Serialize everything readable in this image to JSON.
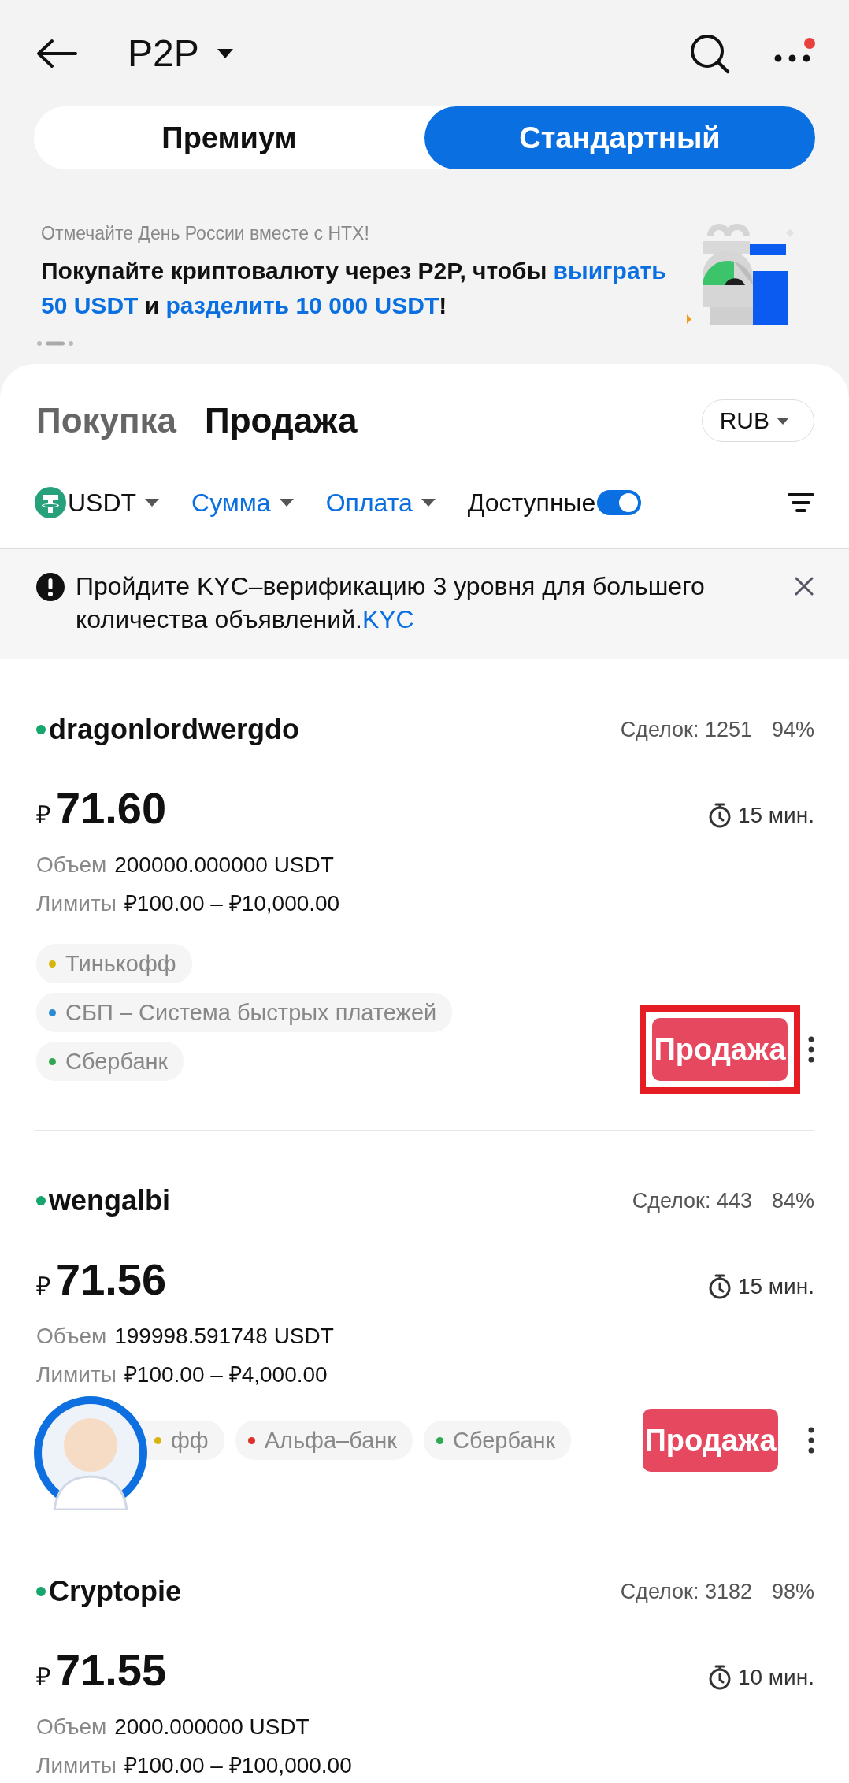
{
  "header": {
    "title": "P2P",
    "notification_dot": true
  },
  "mode_tabs": [
    {
      "label": "Премиум",
      "selected": false
    },
    {
      "label": "Стандартный",
      "selected": true
    }
  ],
  "banner": {
    "subtitle": "Отмечайте День России вместе с HTX!",
    "headline": [
      {
        "text": "Покупайте криптовалюту через P2P, чтобы ",
        "accent": false
      },
      {
        "text": "выиграть 50 USDT",
        "accent": true
      },
      {
        "text": " и ",
        "accent": false
      },
      {
        "text": "разделить 10 000 USDT",
        "accent": true
      },
      {
        "text": "!",
        "accent": false
      }
    ]
  },
  "side_tabs": [
    {
      "label": "Покупка",
      "selected": false
    },
    {
      "label": "Продажа",
      "selected": true
    }
  ],
  "currency": "RUB",
  "filters": [
    {
      "kind": "coin",
      "label": "USDT",
      "accent": false
    },
    {
      "kind": "dropdown",
      "label": "Сумма",
      "accent": true
    },
    {
      "kind": "dropdown",
      "label": "Оплата",
      "accent": true
    },
    {
      "kind": "toggle",
      "label": "Доступные",
      "on": true
    }
  ],
  "notice": {
    "text": "Пройдите KYC–верификацию 3 уровня для большего количества объявлений.",
    "link": "KYC"
  },
  "ads": [
    {
      "name": "dragonlordwergdo",
      "online": true,
      "trades": "Сделок: 1251",
      "rate": "94%",
      "currency": "₽",
      "price": "71.60",
      "time": "15 мин.",
      "volume_label": "Объем",
      "volume": "200000.000000 USDT",
      "limits_label": "Лимиты",
      "limits": "₽100.00 – ₽10,000.00",
      "payments": [
        {
          "name": "Тинькофф",
          "color": "#d8b50c"
        },
        {
          "name": "СБП – Система быстрых платежей",
          "color": "#2a8ad6"
        },
        {
          "name": "Сбербанк",
          "color": "#2fa84f"
        }
      ],
      "action": "Продажа",
      "highlighted": true
    },
    {
      "name": "wengalbi",
      "online": true,
      "trades": "Сделок: 443",
      "rate": "84%",
      "currency": "₽",
      "price": "71.56",
      "time": "15 мин.",
      "volume_label": "Объем",
      "volume": "199998.591748 USDT",
      "limits_label": "Лимиты",
      "limits": "₽100.00 – ₽4,000.00",
      "payments": [
        {
          "name": "фф",
          "color": "#d8b50c"
        },
        {
          "name": "Альфа–банк",
          "color": "#e0302a"
        },
        {
          "name": "Сбербанк",
          "color": "#2fa84f"
        }
      ],
      "action": "Продажа",
      "highlighted": false
    },
    {
      "name": "Cryptopie",
      "online": true,
      "trades": "Сделок: 3182",
      "rate": "98%",
      "currency": "₽",
      "price": "71.55",
      "time": "10 мин.",
      "volume_label": "Объем",
      "volume": "2000.000000 USDT",
      "limits_label": "Лимиты",
      "limits": "₽100.00 – ₽100,000.00"
    }
  ]
}
